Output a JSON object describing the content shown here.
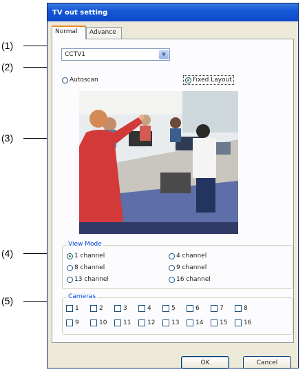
{
  "callouts": [
    "(1)",
    "(2)",
    "(3)",
    "(4)",
    "(5)"
  ],
  "window": {
    "title": "TV out setting"
  },
  "tabs": [
    {
      "label": "Normal",
      "active": true
    },
    {
      "label": "Advance",
      "active": false
    }
  ],
  "normal": {
    "device_select": {
      "value": "CCTV1"
    },
    "scan_mode": {
      "autoscan": "Autoscan",
      "fixed_layout": "Fixed Layout",
      "selected": "fixed_layout"
    },
    "view_mode": {
      "title": "View Mode",
      "options": [
        "1 channel",
        "4 channel",
        "8 channel",
        "9 channel",
        "13 channel",
        "16 channel"
      ],
      "selected": "1 channel"
    },
    "cameras": {
      "title": "Cameras",
      "items": [
        "1",
        "2",
        "3",
        "4",
        "5",
        "6",
        "7",
        "8",
        "9",
        "10",
        "11",
        "12",
        "13",
        "14",
        "15",
        "16"
      ]
    }
  },
  "buttons": {
    "ok": "OK",
    "cancel": "Cancel"
  },
  "icons": {
    "dropdown": "chevron-down-icon"
  },
  "colors": {
    "title_bar": "#0c49c9",
    "tab_accent": "#e68b2c",
    "group_title": "#0046d5",
    "radio_dot": "#21a121"
  }
}
